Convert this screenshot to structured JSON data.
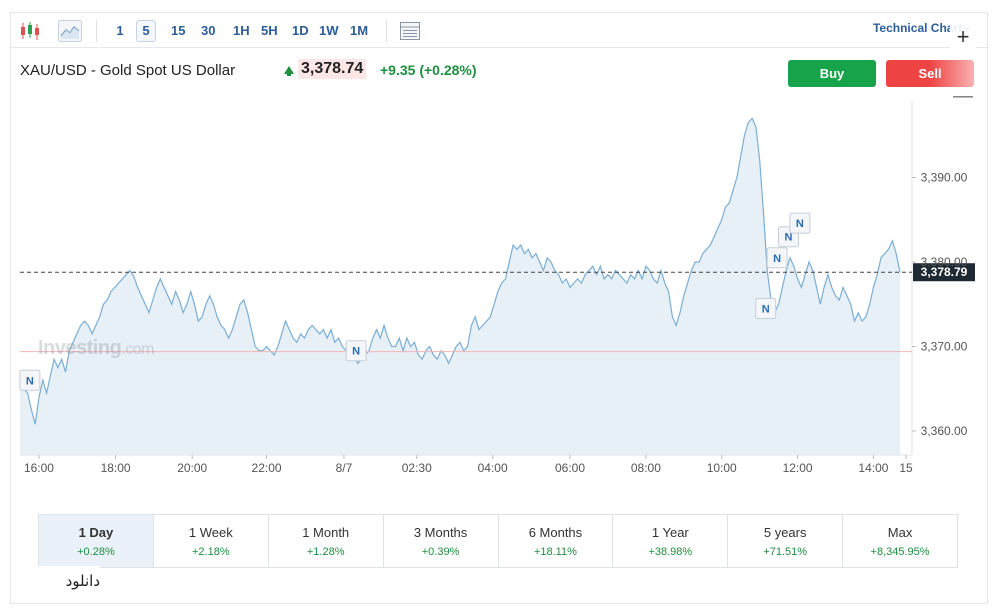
{
  "toolbar": {
    "intervals": [
      "1",
      "5",
      "15",
      "30",
      "1H",
      "5H",
      "1D",
      "1W",
      "1M"
    ],
    "active_interval": "5",
    "technical_chart_label": "Technical Chart",
    "plus_label": "+",
    "minus_label": "—"
  },
  "header": {
    "symbol_title": "XAU/USD - Gold Spot US Dollar",
    "price": "3,378.74",
    "change": "+9.35 (+0.28%)",
    "buy_label": "Buy",
    "sell_label": "Sell"
  },
  "watermark": {
    "brand": "Investing",
    "suffix": ".com"
  },
  "chart_data": {
    "type": "area",
    "y_ticks": [
      "3,360.00",
      "3,370.00",
      "3,380.00",
      "3,390.00"
    ],
    "ylim": [
      3355,
      3405
    ],
    "x_ticks": [
      "16:00",
      "18:00",
      "20:00",
      "22:00",
      "8/7",
      "02:30",
      "04:00",
      "06:00",
      "08:00",
      "10:00",
      "12:00",
      "14:00",
      "15"
    ],
    "current_value_label": "3,378.79",
    "current_value": 3378.79,
    "reference_line": 3369.4,
    "news_marker_label": "N",
    "news_markers": [
      {
        "t": 1.3,
        "y": 3366
      },
      {
        "t": 44.3,
        "y": 3369.5
      },
      {
        "t": 98.3,
        "y": 3374.5
      },
      {
        "t": 99.8,
        "y": 3380.5
      },
      {
        "t": 101.3,
        "y": 3383
      },
      {
        "t": 102.8,
        "y": 3384.6
      }
    ],
    "series": [
      {
        "values": [
          [
            0,
            3365.5
          ],
          [
            0.5,
            3365
          ],
          [
            1,
            3364.5
          ],
          [
            1.5,
            3362.5
          ],
          [
            2,
            3360.8
          ],
          [
            2.5,
            3364
          ],
          [
            3,
            3366
          ],
          [
            3.5,
            3364.5
          ],
          [
            4,
            3366.5
          ],
          [
            4.5,
            3368.5
          ],
          [
            5,
            3367.5
          ],
          [
            5.5,
            3368.5
          ],
          [
            6,
            3367
          ],
          [
            6.5,
            3369.5
          ],
          [
            7,
            3370.5
          ],
          [
            7.5,
            3371.5
          ],
          [
            8,
            3372.5
          ],
          [
            8.5,
            3373
          ],
          [
            9,
            3372.5
          ],
          [
            9.5,
            3371.5
          ],
          [
            10,
            3372.5
          ],
          [
            10.5,
            3373.5
          ],
          [
            11,
            3375
          ],
          [
            11.5,
            3375.5
          ],
          [
            12,
            3376.5
          ],
          [
            12.5,
            3377
          ],
          [
            13,
            3377.5
          ],
          [
            13.5,
            3378
          ],
          [
            14,
            3378.5
          ],
          [
            14.5,
            3379
          ],
          [
            15,
            3378.3
          ],
          [
            15.5,
            3377
          ],
          [
            16,
            3376
          ],
          [
            16.5,
            3375
          ],
          [
            17,
            3374
          ],
          [
            17.5,
            3375.5
          ],
          [
            18,
            3377
          ],
          [
            18.5,
            3378
          ],
          [
            19,
            3377
          ],
          [
            19.5,
            3376
          ],
          [
            20,
            3375
          ],
          [
            20.5,
            3376.5
          ],
          [
            21,
            3375.5
          ],
          [
            21.5,
            3374
          ],
          [
            22,
            3375
          ],
          [
            22.5,
            3376.5
          ],
          [
            23,
            3375
          ],
          [
            23.5,
            3373
          ],
          [
            24,
            3373.5
          ],
          [
            24.5,
            3375
          ],
          [
            25,
            3376
          ],
          [
            25.5,
            3375
          ],
          [
            26,
            3373.5
          ],
          [
            26.5,
            3372.5
          ],
          [
            27,
            3372
          ],
          [
            27.5,
            3371
          ],
          [
            28,
            3372
          ],
          [
            28.5,
            3373.5
          ],
          [
            29,
            3375
          ],
          [
            29.5,
            3375.5
          ],
          [
            30,
            3374
          ],
          [
            30.5,
            3372
          ],
          [
            31,
            3370
          ],
          [
            31.5,
            3369.5
          ],
          [
            32,
            3369.5
          ],
          [
            32.5,
            3370
          ],
          [
            33,
            3369.5
          ],
          [
            33.5,
            3369
          ],
          [
            34,
            3370
          ],
          [
            34.5,
            3371.5
          ],
          [
            35,
            3373
          ],
          [
            35.5,
            3372
          ],
          [
            36,
            3371
          ],
          [
            36.5,
            3370.5
          ],
          [
            37,
            3371.5
          ],
          [
            37.5,
            3371
          ],
          [
            38,
            3372
          ],
          [
            38.5,
            3372.5
          ],
          [
            39,
            3372
          ],
          [
            39.5,
            3371.5
          ],
          [
            40,
            3372
          ],
          [
            40.5,
            3371
          ],
          [
            41,
            3372
          ],
          [
            41.5,
            3370.5
          ],
          [
            42,
            3371
          ],
          [
            42.5,
            3370
          ],
          [
            43,
            3369.5
          ],
          [
            43.5,
            3369
          ],
          [
            44,
            3369.5
          ],
          [
            44.5,
            3368
          ],
          [
            45,
            3368.5
          ],
          [
            45.5,
            3369
          ],
          [
            46,
            3369.5
          ],
          [
            46.5,
            3371
          ],
          [
            47,
            3372
          ],
          [
            47.5,
            3371
          ],
          [
            48,
            3372.5
          ],
          [
            48.5,
            3371
          ],
          [
            49,
            3370
          ],
          [
            49.5,
            3370
          ],
          [
            50,
            3371
          ],
          [
            50.5,
            3369.5
          ],
          [
            51,
            3371
          ],
          [
            51.5,
            3370
          ],
          [
            52,
            3370.5
          ],
          [
            52.5,
            3369
          ],
          [
            53,
            3368.5
          ],
          [
            53.5,
            3369.5
          ],
          [
            54,
            3370
          ],
          [
            54.5,
            3369
          ],
          [
            55,
            3368.5
          ],
          [
            55.5,
            3369.5
          ],
          [
            56,
            3369
          ],
          [
            56.5,
            3368
          ],
          [
            57,
            3369
          ],
          [
            57.5,
            3370
          ],
          [
            58,
            3370.5
          ],
          [
            58.5,
            3369.5
          ],
          [
            59,
            3370
          ],
          [
            59.5,
            3372.5
          ],
          [
            60,
            3373.5
          ],
          [
            60.5,
            3372
          ],
          [
            61,
            3372.5
          ],
          [
            61.5,
            3373
          ],
          [
            62,
            3373.5
          ],
          [
            62.5,
            3375
          ],
          [
            63,
            3376.5
          ],
          [
            63.5,
            3377.5
          ],
          [
            64,
            3378
          ],
          [
            64.5,
            3380
          ],
          [
            65,
            3382
          ],
          [
            65.5,
            3381.5
          ],
          [
            66,
            3382
          ],
          [
            66.5,
            3381
          ],
          [
            67,
            3381.5
          ],
          [
            67.5,
            3380.5
          ],
          [
            68,
            3381
          ],
          [
            68.5,
            3380
          ],
          [
            69,
            3379
          ],
          [
            69.5,
            3380.5
          ],
          [
            70,
            3380
          ],
          [
            70.5,
            3379
          ],
          [
            71,
            3378.5
          ],
          [
            71.5,
            3377.5
          ],
          [
            72,
            3378
          ],
          [
            72.5,
            3377
          ],
          [
            73,
            3377.5
          ],
          [
            73.5,
            3378
          ],
          [
            74,
            3377.5
          ],
          [
            74.5,
            3378.5
          ],
          [
            75,
            3379
          ],
          [
            75.5,
            3379.5
          ],
          [
            76,
            3378.5
          ],
          [
            76.5,
            3379.5
          ],
          [
            77,
            3378
          ],
          [
            77.5,
            3378.5
          ],
          [
            78,
            3378
          ],
          [
            78.5,
            3379
          ],
          [
            79,
            3378.5
          ],
          [
            79.5,
            3378
          ],
          [
            80,
            3377.5
          ],
          [
            80.5,
            3378.5
          ],
          [
            81,
            3378
          ],
          [
            81.5,
            3379
          ],
          [
            82,
            3378
          ],
          [
            82.5,
            3379.5
          ],
          [
            83,
            3379
          ],
          [
            83.5,
            3378
          ],
          [
            84,
            3377.5
          ],
          [
            84.5,
            3379
          ],
          [
            85,
            3377.5
          ],
          [
            85.5,
            3376.5
          ],
          [
            86,
            3373.5
          ],
          [
            86.5,
            3372.5
          ],
          [
            87,
            3374
          ],
          [
            87.5,
            3376
          ],
          [
            88,
            3377.5
          ],
          [
            88.5,
            3379
          ],
          [
            89,
            3380
          ],
          [
            89.5,
            3380
          ],
          [
            90,
            3381
          ],
          [
            90.5,
            3381.5
          ],
          [
            91,
            3382
          ],
          [
            91.5,
            3383
          ],
          [
            92,
            3384
          ],
          [
            92.5,
            3385
          ],
          [
            93,
            3386.5
          ],
          [
            93.5,
            3387
          ],
          [
            94,
            3388.5
          ],
          [
            94.5,
            3390
          ],
          [
            95,
            3392.5
          ],
          [
            95.5,
            3395
          ],
          [
            96,
            3396.5
          ],
          [
            96.5,
            3397
          ],
          [
            97,
            3396
          ],
          [
            97.5,
            3392
          ],
          [
            98,
            3386
          ],
          [
            98.5,
            3379
          ],
          [
            99,
            3375.5
          ],
          [
            99.5,
            3374
          ],
          [
            100,
            3375
          ],
          [
            100.5,
            3377
          ],
          [
            101,
            3379
          ],
          [
            101.5,
            3380.5
          ],
          [
            102,
            3379.5
          ],
          [
            102.5,
            3378
          ],
          [
            103,
            3377
          ],
          [
            103.5,
            3378.5
          ],
          [
            104,
            3380
          ],
          [
            104.5,
            3379
          ],
          [
            105,
            3377
          ],
          [
            105.5,
            3375
          ],
          [
            106,
            3377
          ],
          [
            106.5,
            3378.5
          ],
          [
            107,
            3377
          ],
          [
            107.5,
            3376
          ],
          [
            108,
            3375.5
          ],
          [
            108.5,
            3377
          ],
          [
            109,
            3376
          ],
          [
            109.5,
            3375
          ],
          [
            110,
            3373
          ],
          [
            110.5,
            3374
          ],
          [
            111,
            3373
          ],
          [
            111.5,
            3373.5
          ],
          [
            112,
            3375
          ],
          [
            112.5,
            3377
          ],
          [
            113,
            3378.5
          ],
          [
            113.5,
            3380.5
          ],
          [
            114,
            3381
          ],
          [
            114.5,
            3381.5
          ],
          [
            115,
            3382.5
          ],
          [
            115.5,
            3381
          ],
          [
            116,
            3378.79
          ]
        ]
      }
    ]
  },
  "periods": [
    {
      "label": "1 Day",
      "change": "+0.28%"
    },
    {
      "label": "1 Week",
      "change": "+2.18%"
    },
    {
      "label": "1 Month",
      "change": "+1.28%"
    },
    {
      "label": "3 Months",
      "change": "+0.39%"
    },
    {
      "label": "6 Months",
      "change": "+18.11%"
    },
    {
      "label": "1 Year",
      "change": "+38.98%"
    },
    {
      "label": "5 years",
      "change": "+71.51%"
    },
    {
      "label": "Max",
      "change": "+8,345.95%"
    }
  ],
  "active_period": "1 Day",
  "download_label": "دانلود",
  "colors": {
    "line": "#7aaed6",
    "area": "#e3edf6",
    "up": "#1e8f3e",
    "buy": "#16a34a",
    "sell": "#ef4444",
    "reference_line": "#f2b4b4"
  }
}
